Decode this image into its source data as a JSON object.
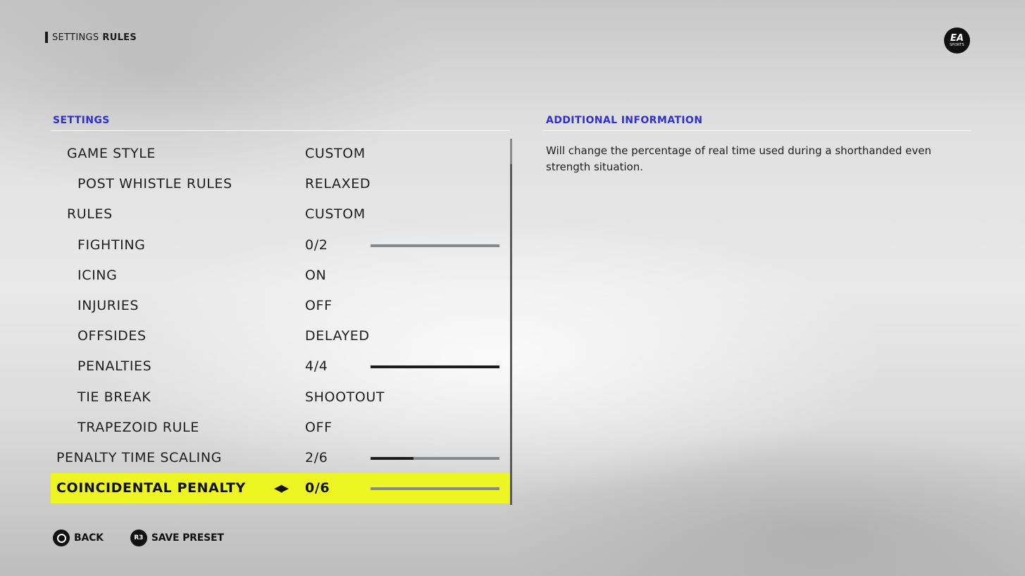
{
  "breadcrumb": {
    "section": "SETTINGS",
    "page": "RULES"
  },
  "logo": {
    "text": "EA",
    "subtext": "SPORTS"
  },
  "left_panel": {
    "title": "SETTINGS"
  },
  "right_panel": {
    "title": "ADDITIONAL INFORMATION",
    "description": "Will change the percentage of real time used during a shorthanded even strength situation."
  },
  "settings": [
    {
      "label": "GAME STYLE",
      "value": "CUSTOM",
      "indent": 1
    },
    {
      "label": "POST WHISTLE RULES",
      "value": "RELAXED",
      "indent": 2
    },
    {
      "label": "RULES",
      "value": "CUSTOM",
      "indent": 1
    },
    {
      "label": "FIGHTING",
      "value": "0/2",
      "indent": 2,
      "slider_level": 0
    },
    {
      "label": "ICING",
      "value": "ON",
      "indent": 2
    },
    {
      "label": "INJURIES",
      "value": "OFF",
      "indent": 2
    },
    {
      "label": "OFFSIDES",
      "value": "DELAYED",
      "indent": 2
    },
    {
      "label": "PENALTIES",
      "value": "4/4",
      "indent": 2,
      "slider_level": 1
    },
    {
      "label": "TIE BREAK",
      "value": "SHOOTOUT",
      "indent": 2
    },
    {
      "label": "TRAPEZOID RULE",
      "value": "OFF",
      "indent": 2
    },
    {
      "label": "PENALTY TIME SCALING",
      "value": "2/6",
      "indent": 0,
      "slider_level": 0.333
    },
    {
      "label": "COINCIDENTAL PENALTY TIM",
      "value": "0/6",
      "indent": 0,
      "slider_level": 0,
      "selected": true
    }
  ],
  "selector_arrows": "◀▶",
  "footer": {
    "back_label": "BACK",
    "back_icon": "circle-button-icon",
    "save_label": "SAVE PRESET",
    "save_icon_text": "R3"
  },
  "colors": {
    "accent_blue": "#2f2fd6",
    "selected_row": "#edf523",
    "slider_track": "#86898c",
    "slider_fill": "#1c1c1c"
  }
}
